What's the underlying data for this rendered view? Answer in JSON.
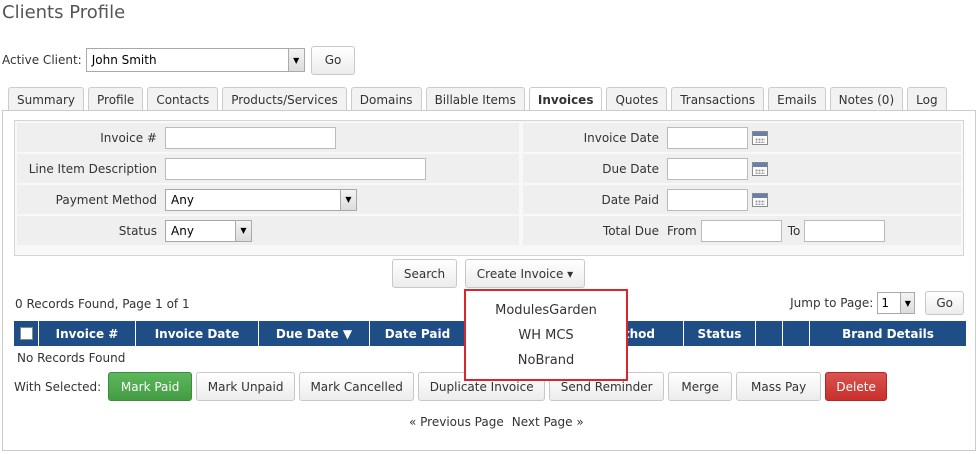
{
  "page": {
    "title": "Clients Profile"
  },
  "client": {
    "label": "Active Client:",
    "selected": "John Smith",
    "go_label": "Go"
  },
  "tabs": [
    {
      "label": "Summary"
    },
    {
      "label": "Profile"
    },
    {
      "label": "Contacts"
    },
    {
      "label": "Products/Services"
    },
    {
      "label": "Domains"
    },
    {
      "label": "Billable Items"
    },
    {
      "label": "Invoices",
      "active": true
    },
    {
      "label": "Quotes"
    },
    {
      "label": "Transactions"
    },
    {
      "label": "Emails"
    },
    {
      "label": "Notes (0)"
    },
    {
      "label": "Log"
    }
  ],
  "filters": {
    "invoice_num": "Invoice #",
    "line_item": "Line Item Description",
    "payment_method": "Payment Method",
    "payment_method_value": "Any",
    "status": "Status",
    "status_value": "Any",
    "invoice_date": "Invoice Date",
    "due_date": "Due Date",
    "date_paid": "Date Paid",
    "total_due": "Total Due",
    "from": "From",
    "to": "To"
  },
  "buttons": {
    "search": "Search",
    "create_invoice": "Create Invoice ▾"
  },
  "records": {
    "info": "0 Records Found, Page 1 of 1",
    "jump_label": "Jump to Page:",
    "jump_value": "1",
    "jump_go": "Go",
    "empty": "No Records Found"
  },
  "table": {
    "columns": [
      "Invoice #",
      "Invoice Date",
      "Due Date ▼",
      "Date Paid",
      "Payment Method",
      "Status",
      "",
      "",
      "Brand Details"
    ]
  },
  "actions": {
    "label": "With Selected:",
    "mark_paid": "Mark Paid",
    "mark_unpaid": "Mark Unpaid",
    "mark_cancelled": "Mark Cancelled",
    "duplicate": "Duplicate Invoice",
    "send_reminder": "Send Reminder",
    "merge": "Merge",
    "mass_pay": "Mass Pay",
    "delete": "Delete"
  },
  "pager": {
    "prev": "« Previous Page",
    "next": "Next Page »"
  },
  "dropdown": {
    "items": [
      "ModulesGarden",
      "WH MCS",
      "NoBrand"
    ]
  },
  "colors": {
    "header": "#1f4e87",
    "highlight": "#d9262c",
    "green": "#5cb85c",
    "red": "#d9534f"
  }
}
